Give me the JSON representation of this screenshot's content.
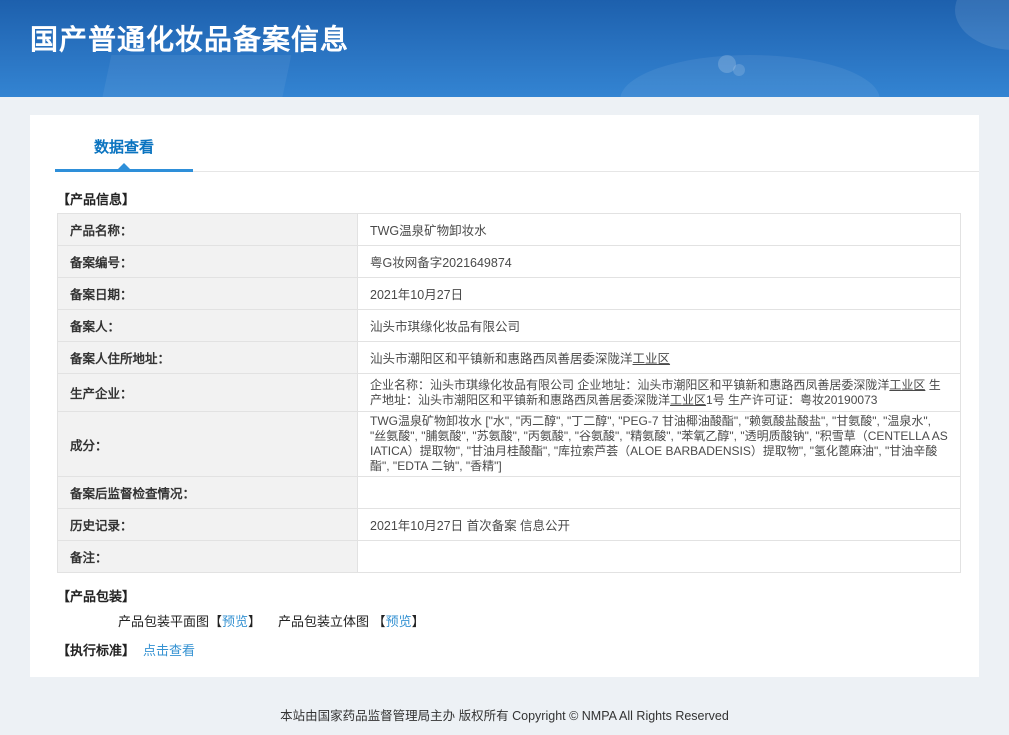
{
  "header": {
    "title": "国产普通化妆品备案信息"
  },
  "tabs": {
    "data_view": "数据查看"
  },
  "sections": {
    "product_info": "【产品信息】",
    "packaging": "【产品包装】",
    "standard": "【执行标准】"
  },
  "table": {
    "rows": {
      "name": {
        "label": "产品名称：",
        "value": "TWG温泉矿物卸妆水"
      },
      "reg_no": {
        "label": "备案编号：",
        "value": "粤G妆网备字2021649874"
      },
      "reg_date": {
        "label": "备案日期：",
        "value": "2021年10月27日"
      },
      "registrant": {
        "label": "备案人：",
        "value": "汕头市琪缘化妆品有限公司"
      },
      "registrant_address": {
        "label": "备案人住所地址：",
        "value_main": "汕头市潮阳区和平镇新和惠路西凤善居委深陇洋",
        "value_underlined": "工业区"
      },
      "manufacturer": {
        "label": "生产企业：",
        "seg1": "企业名称：汕头市琪缘化妆品有限公司 企业地址：汕头市潮阳区和平镇新和惠路西凤善居委深陇洋",
        "u1": "工业区",
        "seg2": " 生产地址：汕头市潮阳区和平镇新和惠路西凤善居委深陇洋",
        "u2": "工业区",
        "seg3": "1号 生产许可证：粤妆20190073"
      },
      "ingredients": {
        "label": "成分：",
        "value": "TWG温泉矿物卸妆水 [\"水\", \"丙二醇\", \"丁二醇\", \"PEG-7 甘油椰油酸酯\", \"赖氨酸盐酸盐\", \"甘氨酸\", \"温泉水\", \"丝氨酸\", \"脯氨酸\", \"苏氨酸\", \"丙氨酸\", \"谷氨酸\", \"精氨酸\", \"苯氧乙醇\", \"透明质酸钠\", \"积雪草（CENTELLA ASIATICA）提取物\", \"甘油月桂酸酯\", \"库拉索芦荟（ALOE BARBADENSIS）提取物\", \"氢化蓖麻油\", \"甘油辛酸酯\", \"EDTA 二钠\", \"香精\"]"
      },
      "supervision": {
        "label": "备案后监督检查情况：",
        "value": ""
      },
      "history": {
        "label": "历史记录：",
        "value": "2021年10月27日 首次备案 信息公开"
      },
      "remark": {
        "label": "备注：",
        "value": ""
      }
    }
  },
  "packaging": {
    "flat_label": "产品包装平面图【",
    "flat_link": "预览",
    "flat_close": "】",
    "stereo_label": "产品包装立体图 【",
    "stereo_link": "预览",
    "stereo_close": "】"
  },
  "standard": {
    "link": "点击查看"
  },
  "footer": {
    "text": "本站由国家药品监督管理局主办 版权所有 Copyright © NMPA All Rights Reserved"
  },
  "colors": {
    "banner_top": "#1d60ad",
    "banner_bottom": "#3384d2",
    "tab_blue": "#0b74c0",
    "tab_underline": "#2e8fd9",
    "link_blue": "#3592d2",
    "table_outer_border": "#9fb6de",
    "table_inner_border": "#e2e2e2",
    "label_cell_bg": "#f2f2f2",
    "page_bg": "#edf1f5"
  }
}
